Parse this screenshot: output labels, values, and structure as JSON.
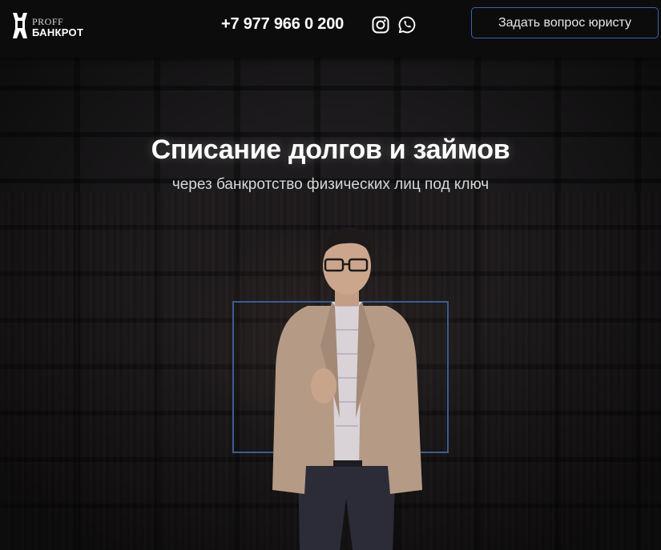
{
  "header": {
    "logo": {
      "line1": "PROFF",
      "line2": "БАНКРОТ"
    },
    "phone": "+7 977 966 0 200",
    "social": [
      "instagram-icon",
      "whatsapp-icon"
    ],
    "cta_label": "Задать вопрос юристу"
  },
  "hero": {
    "title": "Списание долгов и займов",
    "subtitle": "через банкротство физических лиц под ключ"
  },
  "colors": {
    "header_bg": "#0c0c0d",
    "accent_border": "#3d63b0",
    "frame_border": "#3c5b91",
    "text": "#ffffff"
  }
}
